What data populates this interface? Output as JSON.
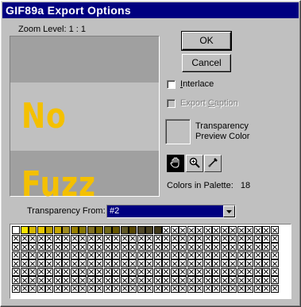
{
  "window": {
    "title": "GIF89a Export Options"
  },
  "zoom": {
    "label": "Zoom Level:  1 :  1"
  },
  "preview": {
    "text": "No Fuzz",
    "text_color": "#f4c000",
    "band_color": "#c0c0c0",
    "bg_color": "#a0a0a0"
  },
  "buttons": {
    "ok": "OK",
    "cancel": "Cancel"
  },
  "options": {
    "interlace": {
      "label": "Interlace",
      "checked": false,
      "enabled": true
    },
    "export_caption": {
      "label": "Export Caption",
      "checked": false,
      "enabled": false
    }
  },
  "transparency_preview": {
    "label_line1": "Transparency",
    "label_line2": "Preview Color",
    "color": "#c0c0c0"
  },
  "tools": [
    {
      "name": "hand-icon",
      "pressed": true
    },
    {
      "name": "zoom-icon",
      "pressed": false
    },
    {
      "name": "eyedropper-icon",
      "pressed": false
    }
  ],
  "palette_info": {
    "label": "Colors in Palette:",
    "count": "18"
  },
  "transparency_from": {
    "label": "Transparency From:",
    "value": "#2"
  },
  "palette": {
    "columns": 32,
    "rows": 8,
    "colors": [
      "#ffffff",
      "#f8e400",
      "#d8b800",
      "#e8c800",
      "#b89c00",
      "#c8a800",
      "#a08c20",
      "#988000",
      "#887800",
      "#807020",
      "#786800",
      "#706818",
      "#685800",
      "#605828",
      "#584800",
      "#504828",
      "#484020",
      "#403818"
    ]
  }
}
